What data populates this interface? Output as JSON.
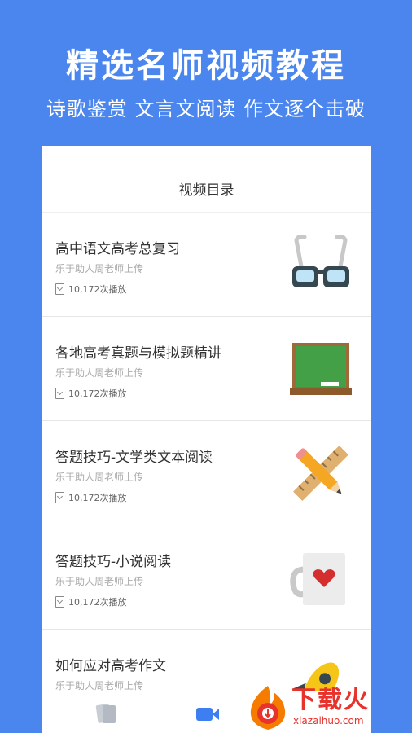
{
  "promo": {
    "headline": "精选名师视频教程",
    "subheadline": "诗歌鉴赏 文言文阅读 作文逐个击破"
  },
  "catalog": {
    "title": "视频目录",
    "items": [
      {
        "title": "高中语文高考总复习",
        "uploader": "乐于助人周老师上传",
        "plays": "10,172次播放",
        "thumb": "glasses-icon"
      },
      {
        "title": "各地高考真题与模拟题精讲",
        "uploader": "乐于助人周老师上传",
        "plays": "10,172次播放",
        "thumb": "chalkboard-icon"
      },
      {
        "title": "答题技巧-文学类文本阅读",
        "uploader": "乐于助人周老师上传",
        "plays": "10,172次播放",
        "thumb": "ruler-pencil-icon"
      },
      {
        "title": "答题技巧-小说阅读",
        "uploader": "乐于助人周老师上传",
        "plays": "10,172次播放",
        "thumb": "heart-mug-icon"
      },
      {
        "title": "如何应对高考作文",
        "uploader": "乐于助人周老师上传",
        "plays": "",
        "thumb": "rocket-icon"
      }
    ]
  },
  "tabs": [
    {
      "name": "cards-tab-icon",
      "active": false
    },
    {
      "name": "video-tab-icon",
      "active": true
    }
  ],
  "watermark": {
    "brand": "下载火",
    "domain": "xiazaihuo.com"
  },
  "colors": {
    "background": "#4a86ee",
    "accent": "#3d7ff0",
    "watermark": "#e8322c"
  }
}
